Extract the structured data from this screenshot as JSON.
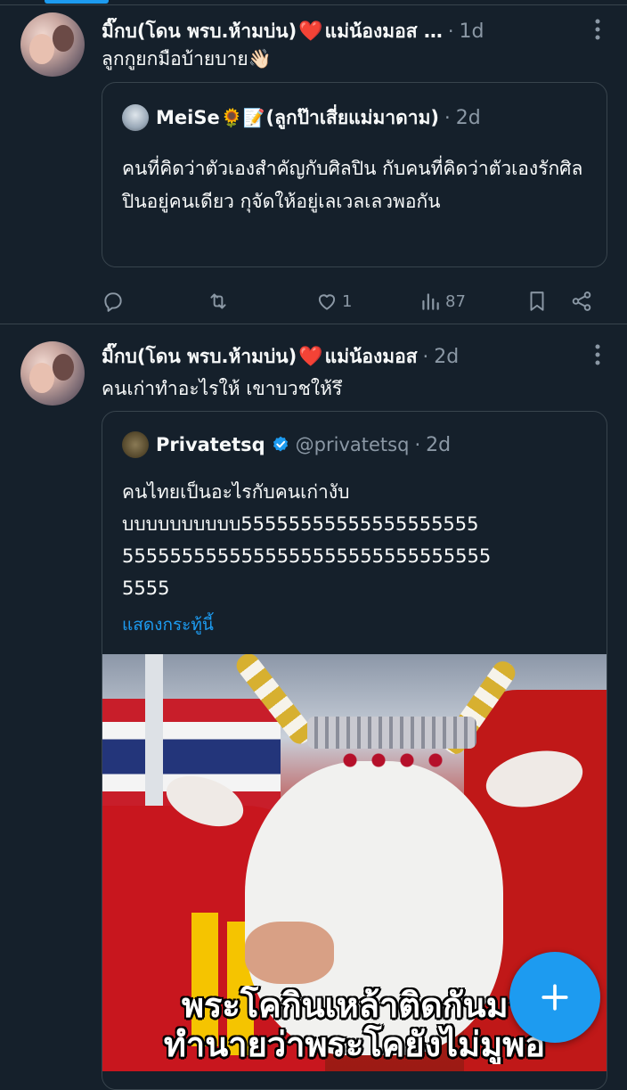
{
  "colors": {
    "background": "#15202b",
    "accent": "#1d9bf0",
    "text_secondary": "#8b98a5",
    "like_heart": "#f91880",
    "border": "#38444d"
  },
  "tweets": [
    {
      "author_name": "มิ๊กบ(โดน พรบ.ห้ามบ่น)",
      "author_heart": "❤️",
      "author_name_suffix": "แม่น้องมอส …",
      "dot": "·",
      "time": "1d",
      "text": "ลูกกูยกมือบ้ายบาย👋🏻",
      "more_icon": "ellipsis-vertical-icon",
      "quote": {
        "author_name": "MeiSe",
        "author_emojis": "🌻📝",
        "author_name_suffix": "(ลูกป๊าเสี่ยแม่มาดาม)",
        "dot": "·",
        "time": "2d",
        "text": "คนที่คิดว่าตัวเองสำคัญกับศิลปิน กับคนที่คิดว่าตัวเองรักศิลปินอยู่คนเดียว กุจัดให้อยู่เลเวลเลวพอกัน"
      },
      "actions": {
        "reply": {
          "icon": "reply-icon",
          "count": ""
        },
        "retweet": {
          "icon": "retweet-icon",
          "count": ""
        },
        "like": {
          "icon": "heart-icon",
          "count": "1"
        },
        "views": {
          "icon": "views-icon",
          "count": "87"
        },
        "bookmark": {
          "icon": "bookmark-icon"
        },
        "share": {
          "icon": "share-icon"
        }
      }
    },
    {
      "author_name": "มิ๊กบ(โดน พรบ.ห้ามบ่น)",
      "author_heart": "❤️",
      "author_name_suffix": "แม่น้องมอส",
      "dot": "·",
      "time": "2d",
      "text": "คนเก่าทำอะไรให้ เขาบวชให้รึ",
      "more_icon": "ellipsis-vertical-icon",
      "quote": {
        "author_name": "Privatetsq",
        "verified": true,
        "handle": "@privatetsq",
        "dot": "·",
        "time": "2d",
        "text_lines": [
          "คนไทยเป็นอะไรกับคนเก่างับ",
          "บบบบบบบบบบ55555555555555555555",
          "5555555555555555555555555555555",
          "5555"
        ],
        "show_thread": "แสดงกระทู้นี้",
        "media_caption_lines": [
          "พระโคกินเหล้าติดกันมา",
          "ทำนายว่าพระโคยังไม่มูพอ"
        ]
      }
    }
  ],
  "compose_button": {
    "icon": "plus-icon"
  }
}
